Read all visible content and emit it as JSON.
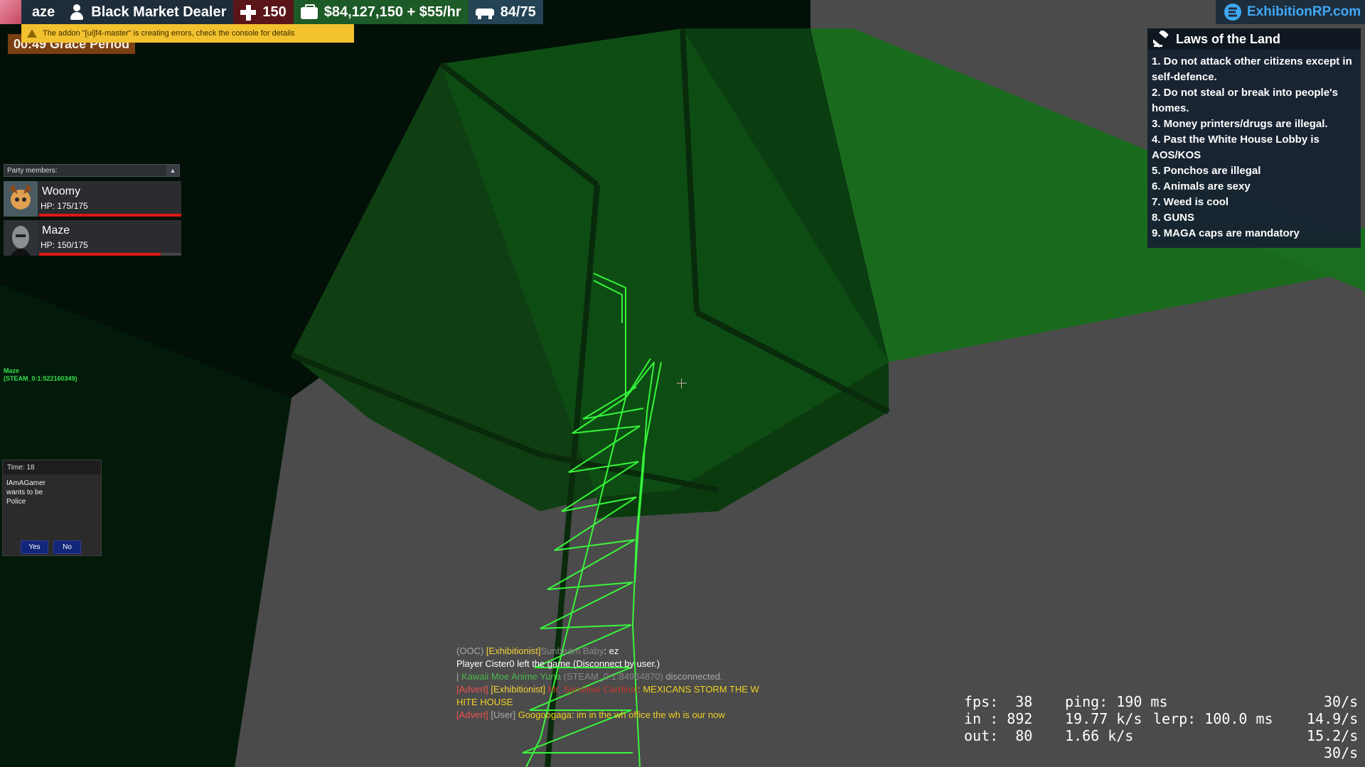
{
  "hud": {
    "name": "aze",
    "job": "Black Market Dealer",
    "health": "150",
    "money": "$84,127,150 + $55/hr",
    "props": "84/75"
  },
  "grace": {
    "text": "00:49 Grace Period"
  },
  "error_banner": {
    "text": "The addon \"[ui]f4-master\" is creating errors, check the console for details"
  },
  "logo": {
    "text": "ExhibitionRP.com"
  },
  "party": {
    "header": "Party members:",
    "members": [
      {
        "name": "Woomy",
        "hp": "HP: 175/175",
        "hp_fraction": 1.0
      },
      {
        "name": "Maze",
        "hp": "HP: 150/175",
        "hp_fraction": 0.857
      }
    ]
  },
  "player_tag": {
    "name": "Maze",
    "steam_id": "(STEAM_0:1:522160349)"
  },
  "vote": {
    "time": "Time: 18",
    "line1": "IAmAGamer",
    "line2": "wants to be",
    "line3": "Police",
    "yes": "Yes",
    "no": "No"
  },
  "laws": {
    "title": "Laws of the Land",
    "items": [
      "1. Do not attack other citizens except in self-defence.",
      "2. Do not steal or break into people's homes.",
      "3. Money printers/drugs are illegal.",
      "4. Past the White House Lobby is AOS/KOS",
      "5. Ponchos are illegal",
      "6. Animals are sexy",
      "7. Weed is cool",
      "8. GUNS",
      "9. MAGA caps are mandatory"
    ]
  },
  "chat": {
    "line1": {
      "tag": "(OOC)",
      "group": "[Exhibitionist]",
      "user": "Sunbeam Baby",
      "msg": ": ez"
    },
    "line2": "Player Cister0 left the game (Disconnect by user.)",
    "line3": {
      "prefix": "| ",
      "user": "Kawaii Moe Anime Yuna",
      "id": " (STEAM_0:1:84964870)",
      "msg": " disconnected."
    },
    "line4": {
      "tag": "[Advert]",
      "group": "[Exhibitionist]",
      "user": "Mr. Sensitive Cardinal",
      "msg": ": MEXICANS STORM THE W"
    },
    "line4b": "HITE HOUSE",
    "line5": {
      "tag": "[Advert]",
      "group": "[User]",
      "user": "Googoogaga",
      "msg": ": im in the wh office the wh is our now"
    }
  },
  "netgraph": {
    "fps": "fps:  38",
    "ping": "ping: 190 ms",
    "rate1": "30/s",
    "in": "in : 892",
    "in_rate": "19.77 k/s",
    "lerp": "lerp: 100.0 ms",
    "rate2": "14.9/s",
    "out": "out:  80",
    "out_rate": "1.66 k/s",
    "rate3": "15.2/s",
    "rate4": "30/s"
  },
  "colors": {
    "money": "#1c5a27",
    "health": "#5a1518",
    "accent": "#3fa9f5",
    "wireframe": "#39ff3c"
  }
}
